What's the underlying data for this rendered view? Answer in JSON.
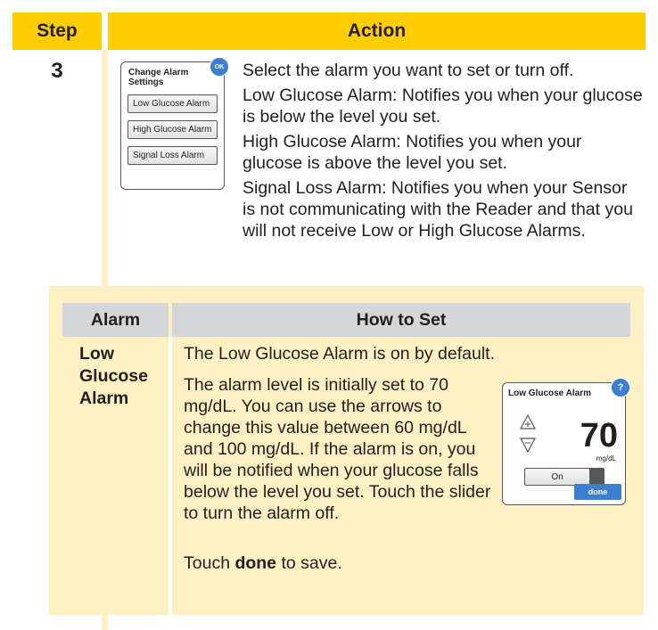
{
  "header": {
    "step": "Step",
    "action": "Action"
  },
  "step_number": "3",
  "screen1": {
    "title": "Change Alarm Settings",
    "ok": "OK",
    "options": [
      "Low Glucose Alarm",
      "High Glucose Alarm",
      "Signal Loss Alarm"
    ]
  },
  "action_paragraphs": [
    "Select the alarm you want to set or turn off.",
    "Low Glucose Alarm: Notifies you when your glucose is below the level you set.",
    "High Glucose Alarm: Notifies you when your glucose is above the level you set.",
    "Signal Loss Alarm: Notifies you when your Sensor is not communicating with the Reader and that you will not receive Low or High Glucose Alarms."
  ],
  "subtable": {
    "col_alarm": "Alarm",
    "col_how": "How to Set",
    "alarm_name": "Low Glucose Alarm",
    "default_text": "The Low Glucose Alarm is on by default.",
    "level_text": "The alarm level is initially set to 70 mg/dL. You can use the arrows to change this value between 60 mg/dL and 100 mg/dL. If the alarm is on, you will be notified when your glucose falls below the level you set. Touch the slider to turn the alarm off.",
    "save_prefix": "Touch ",
    "save_bold": "done",
    "save_suffix": " to save."
  },
  "screen2": {
    "title": "Low Glucose Alarm",
    "help": "?",
    "value": "70",
    "unit": "mg/dL",
    "toggle": "On",
    "done": "done"
  },
  "colors": {
    "header": "#ffcd00",
    "panel": "#fdf1c4",
    "subheader": "#d5d6d8",
    "button": "#3a7fd0"
  }
}
